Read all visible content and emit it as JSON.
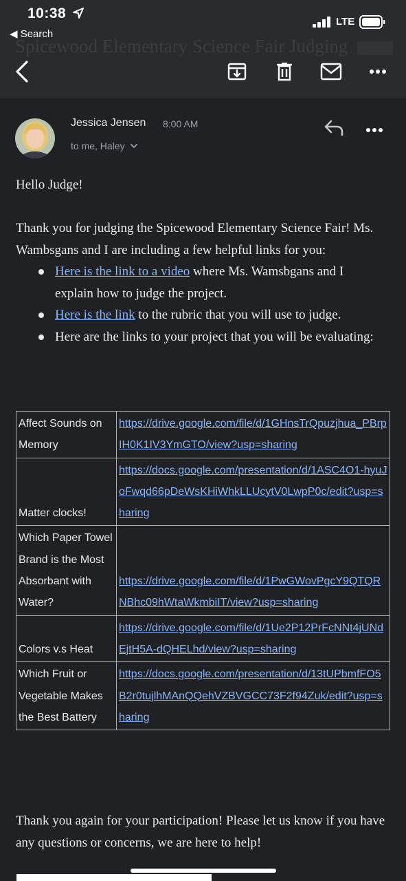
{
  "status_bar": {
    "time": "10:38",
    "back_label": "◀ Search",
    "network": "LTE"
  },
  "toolbar": {
    "subject_ghost": "Spicewood Elementary Science Fair Judging"
  },
  "sender": {
    "name": "Jessica Jensen",
    "time": "8:00 AM",
    "recipients": "to me, Haley"
  },
  "body": {
    "greeting": "Hello Judge!",
    "intro": "Thank you for judging the Spicewood Elementary Science Fair! Ms. Wambsgans and I are including a few helpful links for you:",
    "bullets": [
      {
        "link": "Here is the link to a video",
        "text": " where Ms. Wamsbgans and I explain how to judge the project."
      },
      {
        "link": "Here is the link",
        "text": " to the rubric that you will use to judge."
      },
      {
        "link": "",
        "text": "Here are the links to your project that you will be evaluating:"
      }
    ],
    "projects": [
      {
        "name": "Affect Sounds on Memory",
        "url": "https://drive.google.com/file/d/1GHnsTrQpuzjhua_PBrpIH0K1IV3YmGTO/view?usp=sharing"
      },
      {
        "name": "Matter clocks!",
        "url": "https://docs.google.com/presentation/d/1ASC4O1-hyuJoFwqd66pDeWsKHiWhkLLUcytV0LwpP0c/edit?usp=sharing"
      },
      {
        "name": "Which Paper Towel Brand is the Most Absorbant with Water?",
        "url": "https://drive.google.com/file/d/1PwGWovPgcY9QTQRNBhc09hWtaWkmbiIT/view?usp=sharing"
      },
      {
        "name": "Colors v.s Heat",
        "url": "https://drive.google.com/file/d/1Ue2P12PrFcNNt4jUNdEjtH5A-dQHELhd/view?usp=sharing"
      },
      {
        "name": "Which Fruit or Vegetable Makes the Best Battery",
        "url": "https://docs.google.com/presentation/d/13tUPbmfFO5B2r0tujlhMAnQQehVZBVGCC73F2f94Zuk/edit?usp=sharing"
      }
    ],
    "closing": "Thank you again for your participation! Please let us know if you have any questions or concerns, we are here to help!"
  },
  "icons": {
    "back": "chevron-left-icon",
    "archive": "archive-icon",
    "delete": "trash-icon",
    "mark_unread": "mail-icon",
    "more": "more-horizontal-icon",
    "reply": "reply-icon",
    "expand": "chevron-down-icon",
    "location": "location-arrow-icon"
  },
  "colors": {
    "background": "#202124",
    "header": "#2a2b2e",
    "link": "#8ab4f8",
    "text": "#e8eaed",
    "muted": "#9aa0a6"
  }
}
